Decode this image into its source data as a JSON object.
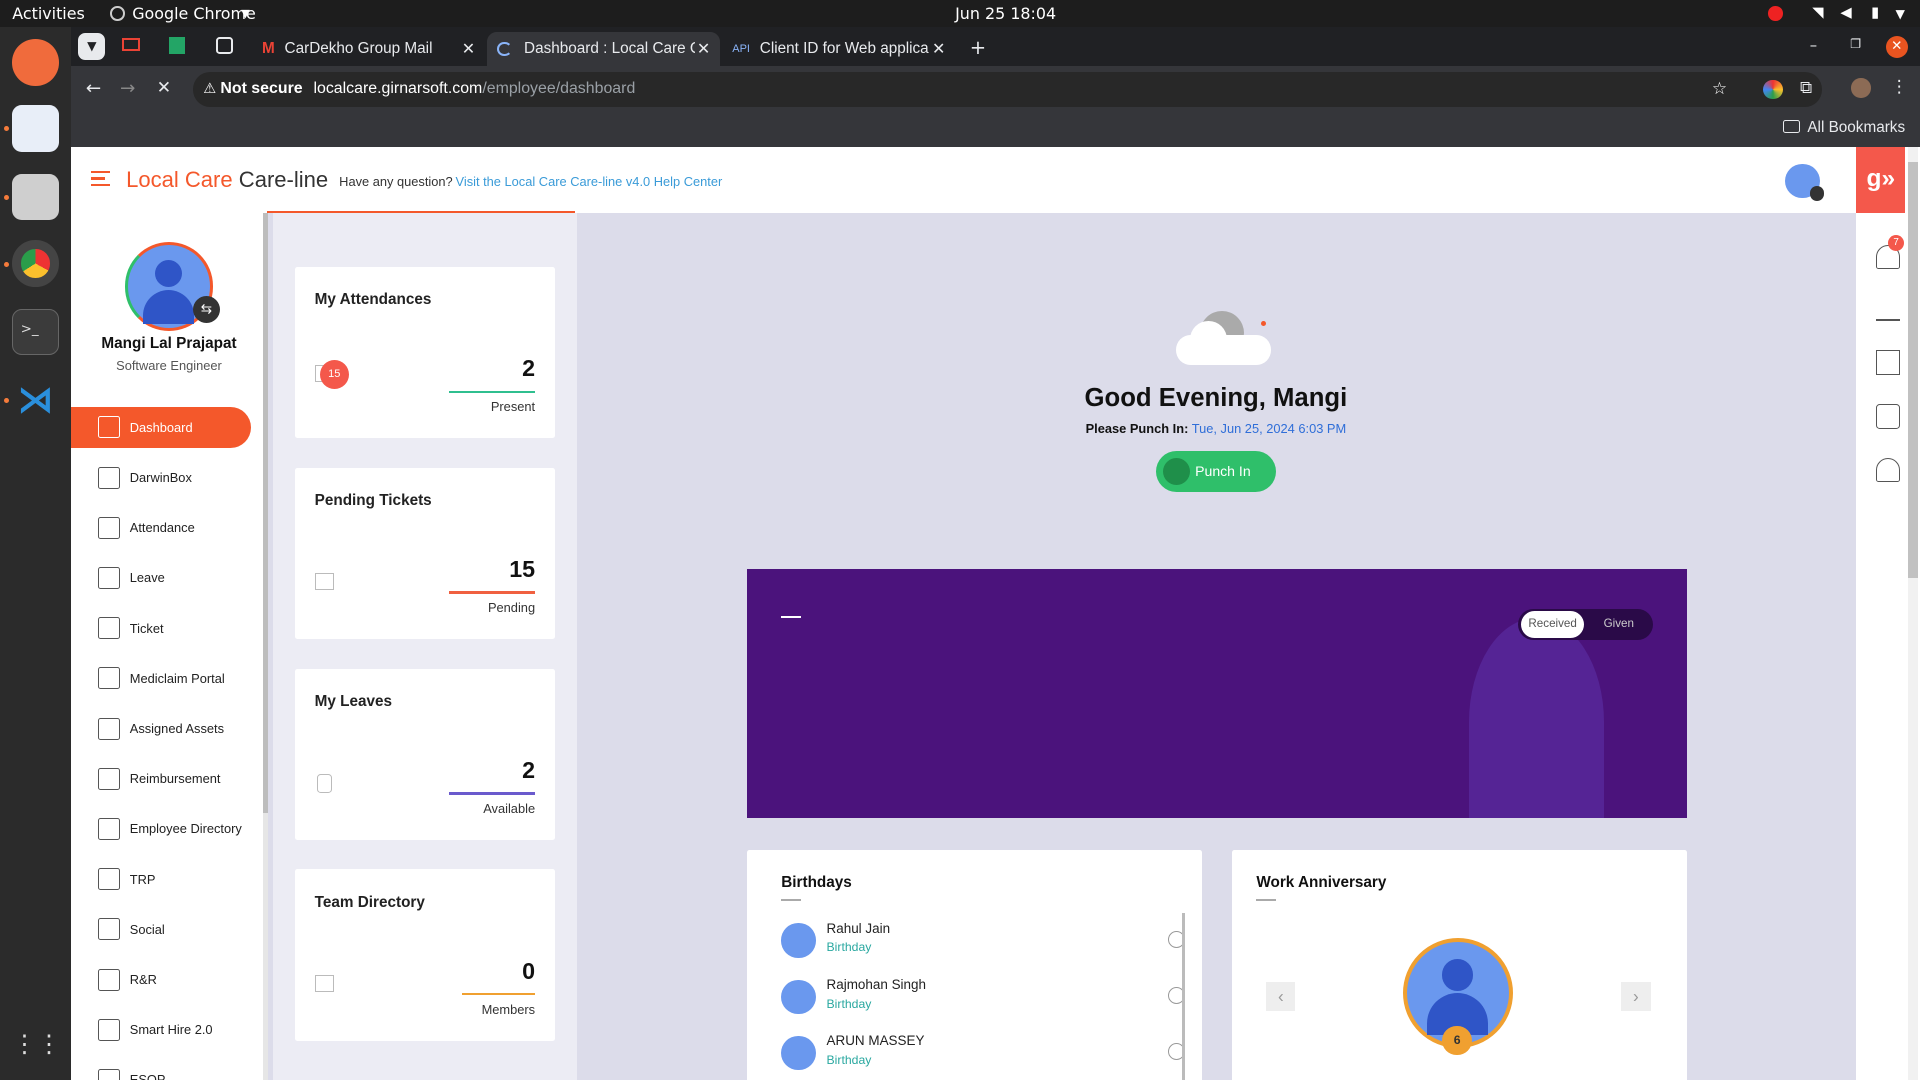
{
  "system": {
    "activities": "Activities",
    "app_name": "Google Chrome",
    "clock": "Jun 25  18:04"
  },
  "tabs": [
    {
      "label": "CarDekho Group Mail"
    },
    {
      "label": "Dashboard : Local Care C"
    },
    {
      "label": "Client ID for Web applica"
    }
  ],
  "omnibox": {
    "security": "Not secure",
    "host": "localcare.girnarsoft.com",
    "path": "/employee/dashboard"
  },
  "bookmarks": {
    "all_label": "All Bookmarks"
  },
  "header": {
    "brand_red": "Local Care",
    "brand_dark": "Care-line",
    "question": "Have any question?",
    "help_link": "Visit the Local Care Care-line v4.0 Help Center",
    "logo": "g»"
  },
  "profile": {
    "name": "Mangi Lal Prajapat",
    "role": "Software Engineer"
  },
  "nav": [
    {
      "label": "Dashboard",
      "icon": "grid-icon"
    },
    {
      "label": "DarwinBox",
      "icon": "darwinbox-icon"
    },
    {
      "label": "Attendance",
      "icon": "calendar-icon"
    },
    {
      "label": "Leave",
      "icon": "chair-icon"
    },
    {
      "label": "Ticket",
      "icon": "ticket-icon"
    },
    {
      "label": "Mediclaim Portal",
      "icon": "shield-icon"
    },
    {
      "label": "Assigned Assets",
      "icon": "assets-icon"
    },
    {
      "label": "Reimbursement",
      "icon": "money-icon"
    },
    {
      "label": "Employee Directory",
      "icon": "book-icon"
    },
    {
      "label": "TRP",
      "icon": "trp-icon"
    },
    {
      "label": "Social",
      "icon": "chat-icon"
    },
    {
      "label": "R&R",
      "icon": "award-icon"
    },
    {
      "label": "Smart Hire 2.0",
      "icon": "people-icon"
    },
    {
      "label": "ESOP",
      "icon": "esop-icon"
    }
  ],
  "cards": [
    {
      "title": "My Attendances",
      "value": "2",
      "label": "Present",
      "badge": "15",
      "line_color": "#2fbf8f"
    },
    {
      "title": "Pending Tickets",
      "value": "15",
      "label": "Pending",
      "line_color": "#f06040"
    },
    {
      "title": "My Leaves",
      "value": "2",
      "label": "Available",
      "line_color": "#6a5acd"
    },
    {
      "title": "Team Directory",
      "value": "0",
      "label": "Members",
      "line_color": "#f0a030"
    }
  ],
  "greeting": {
    "title": "Good Evening, Mangi",
    "punch_prefix": "Please Punch In:",
    "punch_time": "Tue, Jun 25, 2024 6:03 PM",
    "punch_button": "Punch In"
  },
  "banner": {
    "tab_received": "Received",
    "tab_given": "Given",
    "color": "#4b137c"
  },
  "birthdays": {
    "title": "Birthdays",
    "people": [
      {
        "name": "Rahul Jain",
        "status": "Birthday"
      },
      {
        "name": "Rajmohan Singh",
        "status": "Birthday"
      },
      {
        "name": "ARUN MASSEY",
        "status": "Birthday"
      }
    ]
  },
  "anniversary": {
    "title": "Work Anniversary",
    "years": "6"
  },
  "notifications": {
    "count": "7"
  },
  "colors": {
    "accent": "#f4582b",
    "brand_purple": "#4b137c",
    "green": "#2fbf6a"
  }
}
